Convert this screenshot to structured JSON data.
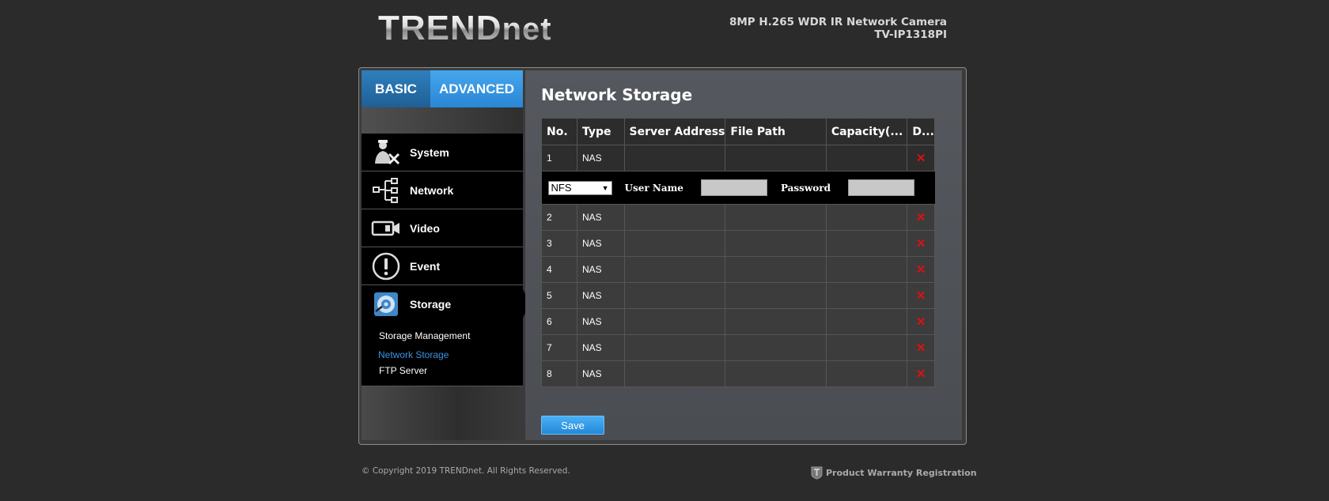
{
  "header": {
    "logo_main": "TREND",
    "logo_net": "net",
    "product_line": "8MP H.265 WDR IR Network Camera",
    "model": "TV-IP1318PI"
  },
  "tabs": [
    {
      "label": "BASIC",
      "active": false
    },
    {
      "label": "ADVANCED",
      "active": true
    }
  ],
  "menu": [
    {
      "label": "System",
      "icon": "system-admin-icon"
    },
    {
      "label": "Network",
      "icon": "network-tree-icon"
    },
    {
      "label": "Video",
      "icon": "video-camera-icon"
    },
    {
      "label": "Event",
      "icon": "exclamation-icon"
    },
    {
      "label": "Storage",
      "icon": "storage-disk-icon"
    }
  ],
  "storage_submenu": [
    {
      "label": "Storage Management",
      "active": false
    },
    {
      "label": "Network Storage",
      "active": true
    },
    {
      "label": "FTP Server",
      "active": false
    }
  ],
  "main": {
    "title": "Network Storage",
    "columns": [
      "No.",
      "Type",
      "Server Address",
      "File Path",
      "Capacity(...",
      "D..."
    ],
    "rows": [
      {
        "no": "1",
        "type": "NAS",
        "server": "",
        "path": "",
        "capacity": ""
      },
      {
        "no": "2",
        "type": "NAS",
        "server": "",
        "path": "",
        "capacity": ""
      },
      {
        "no": "3",
        "type": "NAS",
        "server": "",
        "path": "",
        "capacity": ""
      },
      {
        "no": "4",
        "type": "NAS",
        "server": "",
        "path": "",
        "capacity": ""
      },
      {
        "no": "5",
        "type": "NAS",
        "server": "",
        "path": "",
        "capacity": ""
      },
      {
        "no": "6",
        "type": "NAS",
        "server": "",
        "path": "",
        "capacity": ""
      },
      {
        "no": "7",
        "type": "NAS",
        "server": "",
        "path": "",
        "capacity": ""
      },
      {
        "no": "8",
        "type": "NAS",
        "server": "",
        "path": "",
        "capacity": ""
      }
    ],
    "detail": {
      "protocol_selected": "NFS",
      "username_label": "User Name",
      "username_value": "",
      "password_label": "Password",
      "password_value": ""
    },
    "delete_glyph": "✕",
    "save_label": "Save"
  },
  "footer": {
    "copyright": "© Copyright 2019 TRENDnet. All Rights Reserved.",
    "warranty": "Product Warranty Registration"
  },
  "colors": {
    "accent_blue": "#2a86d6",
    "delete_red": "#d11111",
    "active_link": "#3a93e0"
  }
}
